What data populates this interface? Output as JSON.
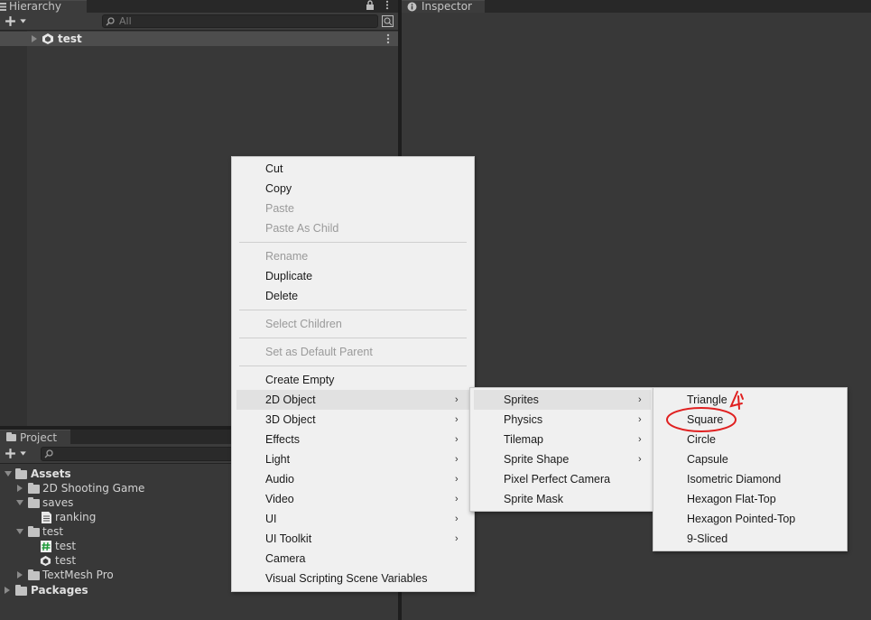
{
  "hierarchy": {
    "tab_label": "Hierarchy",
    "search_placeholder": "All",
    "scene_name": "test"
  },
  "inspector": {
    "tab_label": "Inspector"
  },
  "project": {
    "tab_label": "Project",
    "tree": [
      {
        "label": "Assets"
      },
      {
        "label": "2D Shooting Game"
      },
      {
        "label": "saves"
      },
      {
        "label": "ranking"
      },
      {
        "label": "test"
      },
      {
        "label": "test"
      },
      {
        "label": "test"
      },
      {
        "label": "TextMesh Pro"
      },
      {
        "label": "Packages"
      }
    ]
  },
  "context_menu": {
    "items": [
      {
        "label": "Cut"
      },
      {
        "label": "Copy"
      },
      {
        "label": "Paste"
      },
      {
        "label": "Paste As Child"
      },
      {
        "label": "Rename"
      },
      {
        "label": "Duplicate"
      },
      {
        "label": "Delete"
      },
      {
        "label": "Select Children"
      },
      {
        "label": "Set as Default Parent"
      },
      {
        "label": "Create Empty"
      },
      {
        "label": "2D Object"
      },
      {
        "label": "3D Object"
      },
      {
        "label": "Effects"
      },
      {
        "label": "Light"
      },
      {
        "label": "Audio"
      },
      {
        "label": "Video"
      },
      {
        "label": "UI"
      },
      {
        "label": "UI Toolkit"
      },
      {
        "label": "Camera"
      },
      {
        "label": "Visual Scripting Scene Variables"
      }
    ]
  },
  "submenu_2d": {
    "items": [
      {
        "label": "Sprites"
      },
      {
        "label": "Physics"
      },
      {
        "label": "Tilemap"
      },
      {
        "label": "Sprite Shape"
      },
      {
        "label": "Pixel Perfect Camera"
      },
      {
        "label": "Sprite Mask"
      }
    ]
  },
  "submenu_sprites": {
    "items": [
      {
        "label": "Triangle"
      },
      {
        "label": "Square"
      },
      {
        "label": "Circle"
      },
      {
        "label": "Capsule"
      },
      {
        "label": "Isometric Diamond"
      },
      {
        "label": "Hexagon Flat-Top"
      },
      {
        "label": "Hexagon Pointed-Top"
      },
      {
        "label": "9-Sliced"
      }
    ]
  },
  "annotation": {
    "color": "#e02020"
  }
}
